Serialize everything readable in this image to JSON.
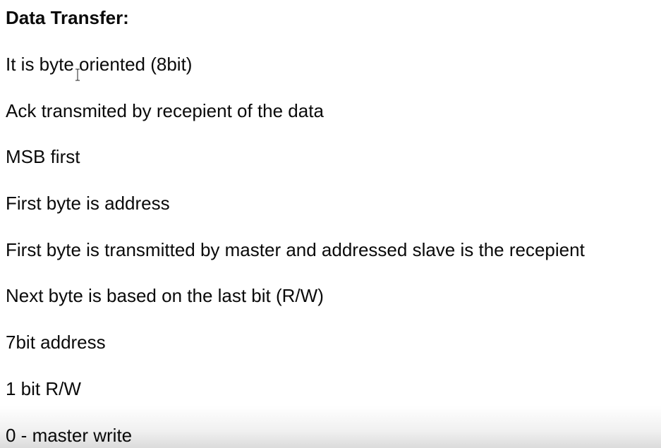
{
  "document": {
    "heading": "Data Transfer:",
    "lines": [
      "It is byte oriented (8bit)",
      "Ack transmited by recepient of the data",
      "MSB first",
      "First byte is address",
      "First byte is transmitted by master and addressed slave is the recepient",
      "Next byte is based on the last bit (R/W)",
      "7bit address",
      "1 bit R/W",
      "0 - master write"
    ]
  },
  "cursor": {
    "icon": "text-cursor-icon"
  }
}
